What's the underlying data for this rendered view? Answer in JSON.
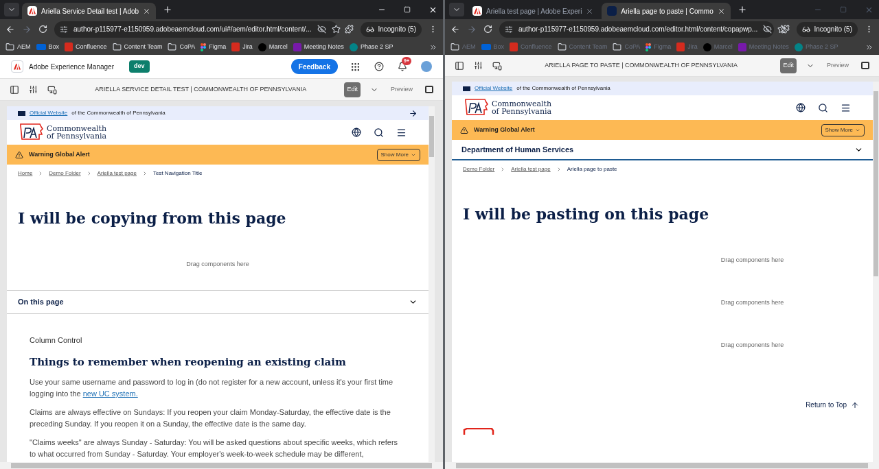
{
  "windows": [
    {
      "tabs": [
        {
          "title": "Ariella Service Detail test | Adob",
          "kind": "adobe",
          "selected": true
        }
      ],
      "url": "author-p115977-e1150959.adobeaemcloud.com/ui#/aem/editor.html/content/...",
      "profile": "Incognito (5)",
      "bookmarks": [
        {
          "label": "AEM",
          "kind": "folder"
        },
        {
          "label": "Box",
          "kind": "box"
        },
        {
          "label": "Confluence",
          "kind": "confluence"
        },
        {
          "label": "Content Team",
          "kind": "folder"
        },
        {
          "label": "CoPA",
          "kind": "folder"
        },
        {
          "label": "Figma",
          "kind": "figma"
        },
        {
          "label": "Jira",
          "kind": "jira"
        },
        {
          "label": "Marcel",
          "kind": "dot"
        },
        {
          "label": "Meeting Notes",
          "kind": "onenote"
        },
        {
          "label": "Phase 2 SP",
          "kind": "sharepoint"
        }
      ],
      "aem_header": {
        "product": "Adobe Experience Manager",
        "environment": "dev",
        "feedback": "Feedback",
        "notifications": "9+"
      },
      "editor": {
        "title": "ARIELLA SERVICE DETAIL TEST | COMMONWEALTH OF PENNSYLVANIA",
        "modes": [
          {
            "label": "Edit",
            "selected": true
          },
          {
            "label": "Preview",
            "selected": false
          }
        ]
      },
      "page": {
        "banner_link": "Official Website",
        "banner_text": "of the Commonwealth of Pennsylvania",
        "logo_line_1": "Commonwealth",
        "logo_line_2": "of Pennsylvania",
        "alert": "Warning Global Alert",
        "alert_button": "Show More",
        "breadcrumbs": [
          {
            "label": "Home",
            "current": false
          },
          {
            "label": "Demo Folder",
            "current": false
          },
          {
            "label": "Ariella test page",
            "current": false
          },
          {
            "label": "Test Navigation Title",
            "current": true
          }
        ],
        "heading": "I will be copying from this page",
        "sections": [
          {
            "kind": "drop_zone",
            "text": "Drag components here"
          },
          {
            "kind": "accordion",
            "title": "On this page",
            "expanded": false
          },
          {
            "kind": "rich_text",
            "label": "Column Control",
            "heading": "Things to remember when reopening an existing claim",
            "paragraphs": [
              {
                "text": "Use your same username and password to log in (do not register for a new account, unless it's your first time logging into the ",
                "link": "new UC system."
              },
              {
                "text": "Claims are always effective on Sundays:  If you reopen your claim Monday-Saturday, the effective date is the preceding Sunday. If you reopen it on a Sunday, the effective date is the same day."
              },
              {
                "text": "\"Claims weeks\" are always Sunday - Saturday: You will be asked questions about specific weeks, which refers to what occurred from Sunday - Saturday.  Your employer's week-to-week schedule may be different,"
              }
            ]
          }
        ]
      }
    },
    {
      "tabs": [
        {
          "title": "Ariella test page | Adobe Experi",
          "kind": "adobe",
          "selected": false
        },
        {
          "title": "Ariella page to paste | Commo",
          "kind": "pa",
          "selected": true
        }
      ],
      "url": "author-p115977-e1150959.adobeaemcloud.com/editor.html/content/copapwp...",
      "profile": "Incognito (5)",
      "bookmarks": [
        {
          "label": "AEM",
          "kind": "folder"
        },
        {
          "label": "Box",
          "kind": "box"
        },
        {
          "label": "Confluence",
          "kind": "confluence"
        },
        {
          "label": "Content Team",
          "kind": "folder"
        },
        {
          "label": "CoPA",
          "kind": "folder"
        },
        {
          "label": "Figma",
          "kind": "figma"
        },
        {
          "label": "Jira",
          "kind": "jira"
        },
        {
          "label": "Marcel",
          "kind": "dot"
        },
        {
          "label": "Meeting Notes",
          "kind": "onenote"
        },
        {
          "label": "Phase 2 SP",
          "kind": "sharepoint"
        }
      ],
      "editor": {
        "title": "ARIELLA PAGE TO PASTE | COMMONWEALTH OF PENNSYLVANIA",
        "modes": [
          {
            "label": "Edit",
            "selected": true
          },
          {
            "label": "Preview",
            "selected": false
          }
        ]
      },
      "page": {
        "banner_link": "Official Website",
        "banner_text": "of the Commonwealth of Pennsylvania",
        "logo_line_1": "Commonwealth",
        "logo_line_2": "of Pennsylvania",
        "alert": "Warning Global Alert",
        "alert_button": "Show More",
        "department": "Department of Human Services",
        "breadcrumbs": [
          {
            "label": "Demo Folder",
            "current": false
          },
          {
            "label": "Ariella test page",
            "current": false
          },
          {
            "label": "Ariella page to paste",
            "current": true
          }
        ],
        "heading": "I will be pasting on this page",
        "sections": [
          {
            "kind": "drop_zone",
            "text": "Drag components here"
          },
          {
            "kind": "drop_zone",
            "text": "Drag components here"
          },
          {
            "kind": "drop_zone",
            "text": "Drag components here"
          },
          {
            "kind": "back_to_top",
            "label": "Return to Top"
          },
          {
            "kind": "footer_logo"
          }
        ]
      }
    }
  ]
}
